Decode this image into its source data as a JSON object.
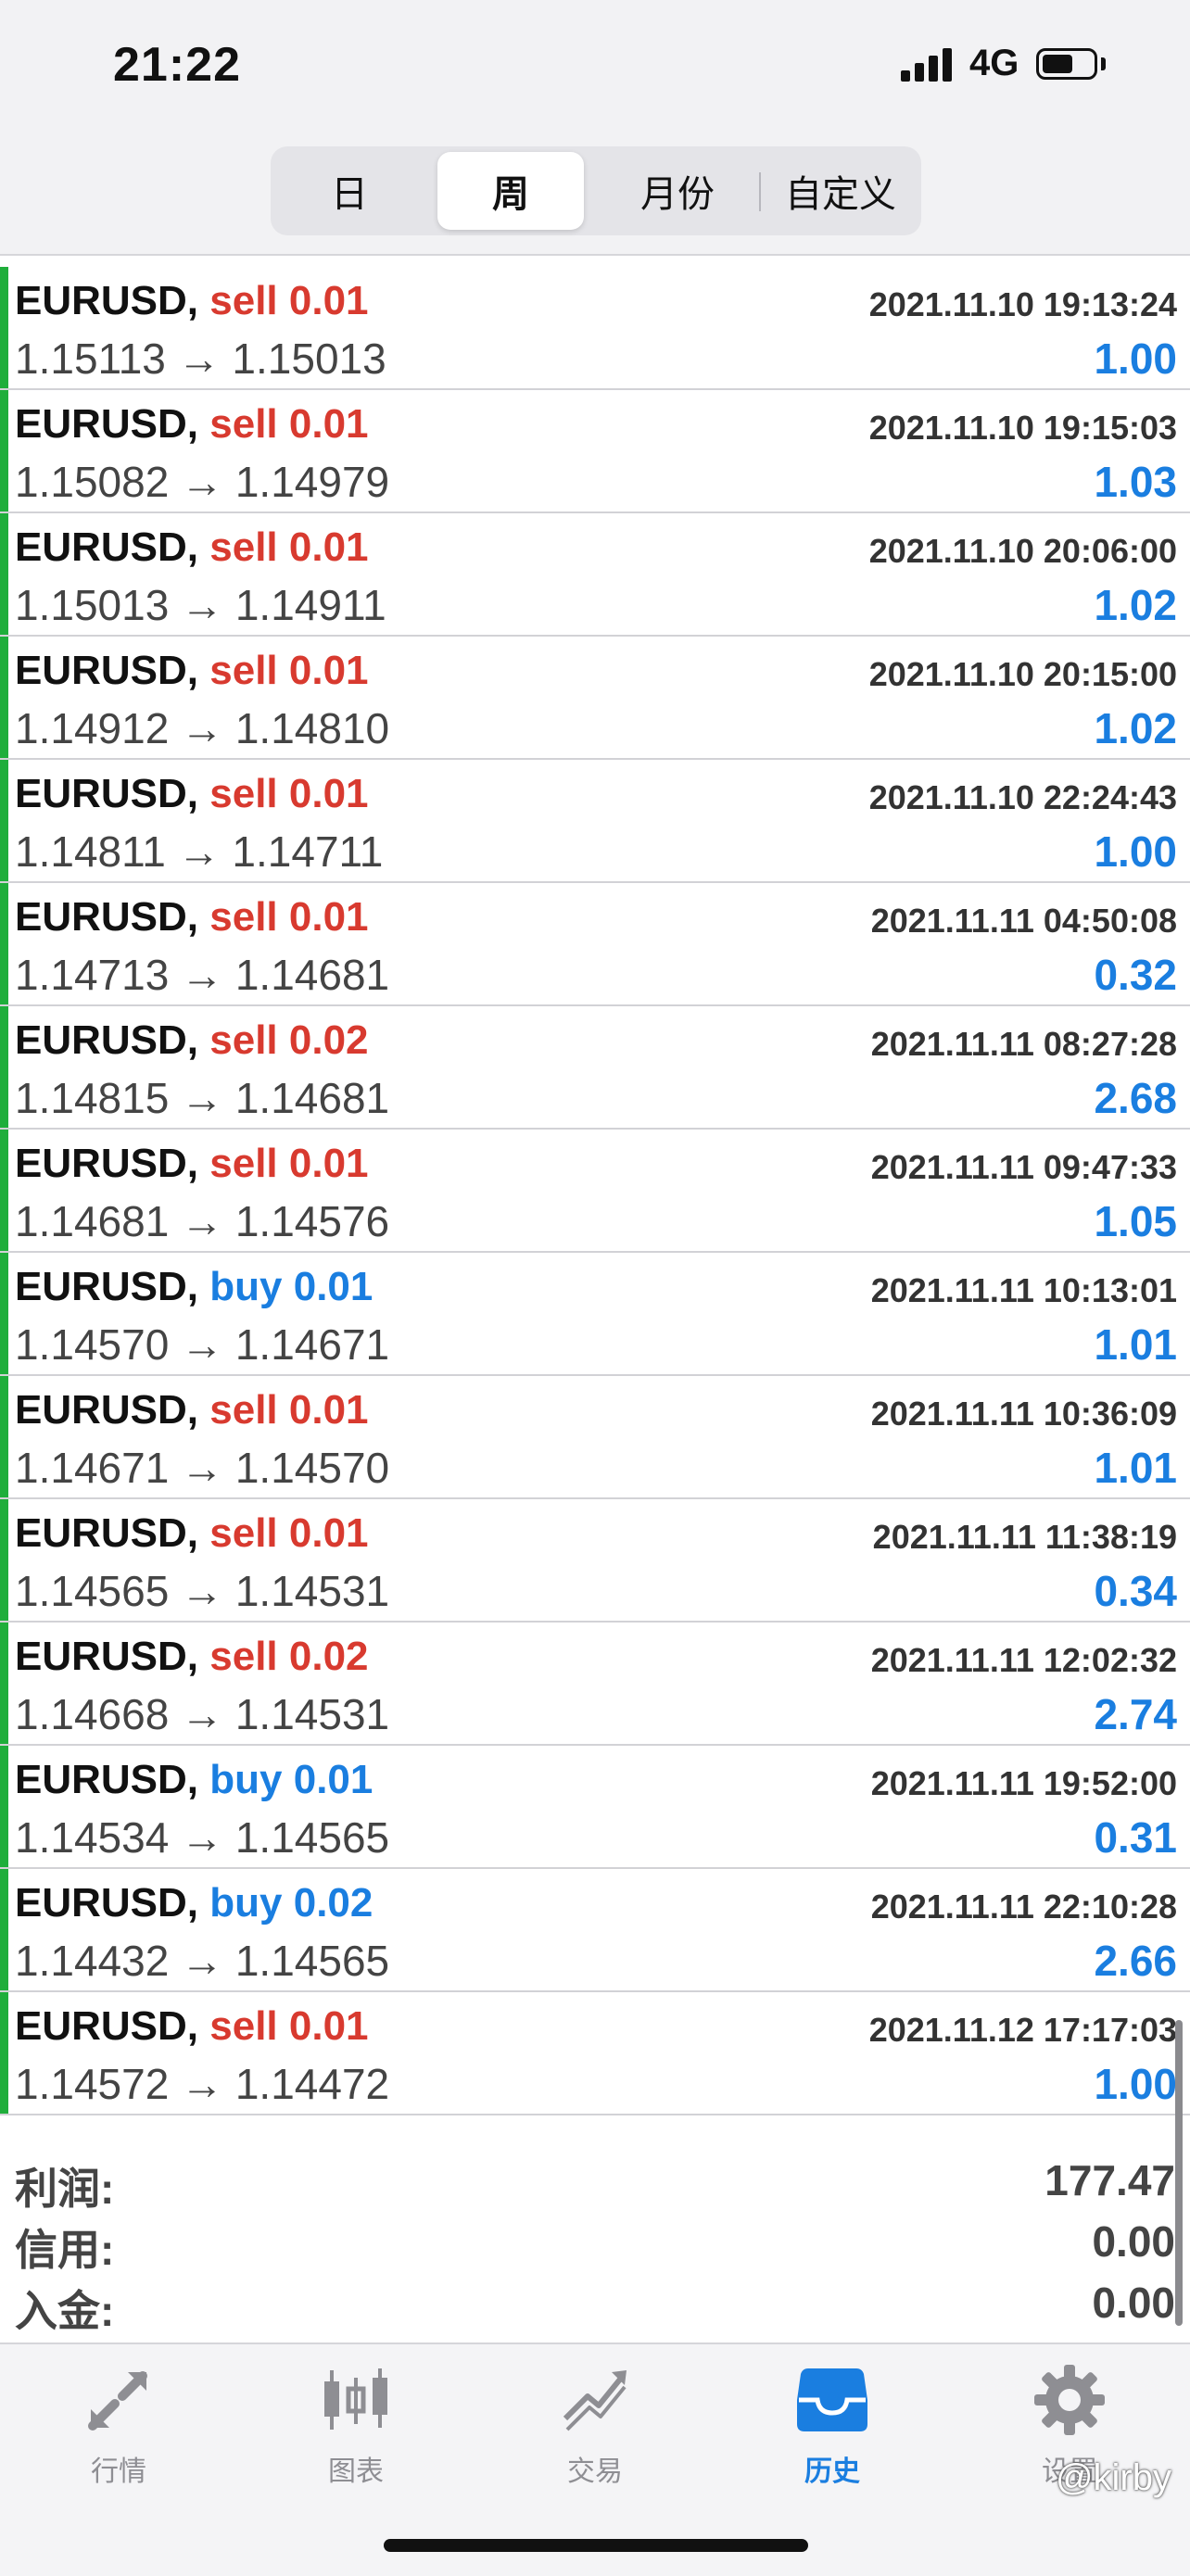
{
  "status_bar": {
    "time": "21:22",
    "network": "4G",
    "signal_bars": 4,
    "battery_level": 0.6
  },
  "period_tabs": [
    {
      "label": "日",
      "active": false
    },
    {
      "label": "周",
      "active": true
    },
    {
      "label": "月份",
      "active": false
    },
    {
      "label": "自定义",
      "active": false
    }
  ],
  "deals": [
    {
      "symbol": "EURUSD,",
      "side": "sell",
      "volume": "0.01",
      "time": "2021.11.10 19:13:24",
      "prices": "1.15113 → 1.15013",
      "profit": "1.00"
    },
    {
      "symbol": "EURUSD,",
      "side": "sell",
      "volume": "0.01",
      "time": "2021.11.10 19:15:03",
      "prices": "1.15082 → 1.14979",
      "profit": "1.03"
    },
    {
      "symbol": "EURUSD,",
      "side": "sell",
      "volume": "0.01",
      "time": "2021.11.10 20:06:00",
      "prices": "1.15013 → 1.14911",
      "profit": "1.02"
    },
    {
      "symbol": "EURUSD,",
      "side": "sell",
      "volume": "0.01",
      "time": "2021.11.10 20:15:00",
      "prices": "1.14912 → 1.14810",
      "profit": "1.02"
    },
    {
      "symbol": "EURUSD,",
      "side": "sell",
      "volume": "0.01",
      "time": "2021.11.10 22:24:43",
      "prices": "1.14811 → 1.14711",
      "profit": "1.00"
    },
    {
      "symbol": "EURUSD,",
      "side": "sell",
      "volume": "0.01",
      "time": "2021.11.11 04:50:08",
      "prices": "1.14713 → 1.14681",
      "profit": "0.32"
    },
    {
      "symbol": "EURUSD,",
      "side": "sell",
      "volume": "0.02",
      "time": "2021.11.11 08:27:28",
      "prices": "1.14815 → 1.14681",
      "profit": "2.68"
    },
    {
      "symbol": "EURUSD,",
      "side": "sell",
      "volume": "0.01",
      "time": "2021.11.11 09:47:33",
      "prices": "1.14681 → 1.14576",
      "profit": "1.05"
    },
    {
      "symbol": "EURUSD,",
      "side": "buy",
      "volume": "0.01",
      "time": "2021.11.11 10:13:01",
      "prices": "1.14570 → 1.14671",
      "profit": "1.01"
    },
    {
      "symbol": "EURUSD,",
      "side": "sell",
      "volume": "0.01",
      "time": "2021.11.11 10:36:09",
      "prices": "1.14671 → 1.14570",
      "profit": "1.01"
    },
    {
      "symbol": "EURUSD,",
      "side": "sell",
      "volume": "0.01",
      "time": "2021.11.11 11:38:19",
      "prices": "1.14565 → 1.14531",
      "profit": "0.34"
    },
    {
      "symbol": "EURUSD,",
      "side": "sell",
      "volume": "0.02",
      "time": "2021.11.11 12:02:32",
      "prices": "1.14668 → 1.14531",
      "profit": "2.74"
    },
    {
      "symbol": "EURUSD,",
      "side": "buy",
      "volume": "0.01",
      "time": "2021.11.11 19:52:00",
      "prices": "1.14534 → 1.14565",
      "profit": "0.31"
    },
    {
      "symbol": "EURUSD,",
      "side": "buy",
      "volume": "0.02",
      "time": "2021.11.11 22:10:28",
      "prices": "1.14432 → 1.14565",
      "profit": "2.66"
    },
    {
      "symbol": "EURUSD,",
      "side": "sell",
      "volume": "0.01",
      "time": "2021.11.12 17:17:03",
      "prices": "1.14572 → 1.14472",
      "profit": "1.00"
    }
  ],
  "summary": [
    {
      "label": "利润:",
      "value": "177.47"
    },
    {
      "label": "信用:",
      "value": "0.00"
    },
    {
      "label": "入金:",
      "value": "0.00"
    }
  ],
  "colors": {
    "sell": "#d83a2f",
    "buy": "#1a7ee0",
    "profit": "#1a7ee0",
    "row_marker": "#1fae3b",
    "tab_active": "#1a7ee0",
    "tab_inactive": "#8e8e93"
  },
  "tab_bar": [
    {
      "label": "行情",
      "icon": "quotes-arrows-icon",
      "active": false
    },
    {
      "label": "图表",
      "icon": "candlestick-chart-icon",
      "active": false
    },
    {
      "label": "交易",
      "icon": "trade-trend-icon",
      "active": false
    },
    {
      "label": "历史",
      "icon": "history-inbox-icon",
      "active": true
    },
    {
      "label": "设置",
      "icon": "gear-icon",
      "active": false
    }
  ],
  "watermark": "@kirby"
}
